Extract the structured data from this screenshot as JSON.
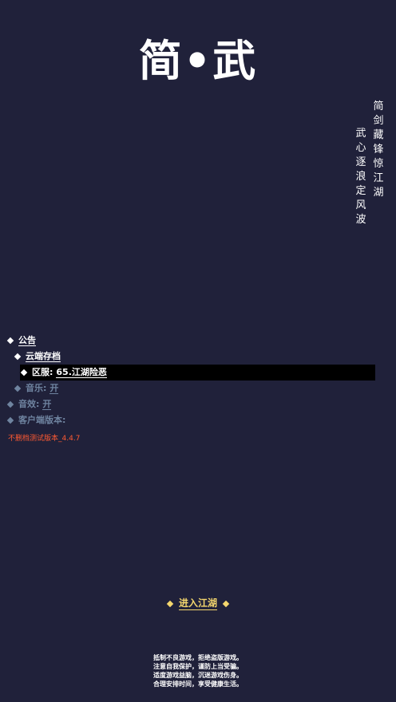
{
  "title": "简•武",
  "poem": {
    "col1": [
      "简",
      "剑",
      "藏",
      "锋",
      "惊",
      "江",
      "湖"
    ],
    "col2": [
      "武",
      "心",
      "逐",
      "浪",
      "定",
      "风",
      "波"
    ]
  },
  "menu": {
    "announcement": "公告",
    "cloud_save": "云端存档",
    "server_label": "区服:",
    "server_value": "65.江湖险恶",
    "music_label": "音乐:",
    "music_value": "开",
    "sfx_label": "音效:",
    "sfx_value": "开",
    "client_version_label": "客户端版本:"
  },
  "version_note": "不删档测试版本_4.4.7",
  "enter_button": "进入江湖",
  "notice": [
    "抵制不良游戏，拒绝盗版游戏。",
    "注意自我保护，谨防上当受骗。",
    "适度游戏益脑，沉迷游戏伤身。",
    "合理安排时间，享受健康生活。"
  ],
  "colors": {
    "background": "#20213a",
    "accent_gold": "#f5d76e",
    "dim_text": "#6f84a0",
    "warning": "#ff5a32"
  },
  "icons": {
    "bullet": "diamond-icon"
  }
}
